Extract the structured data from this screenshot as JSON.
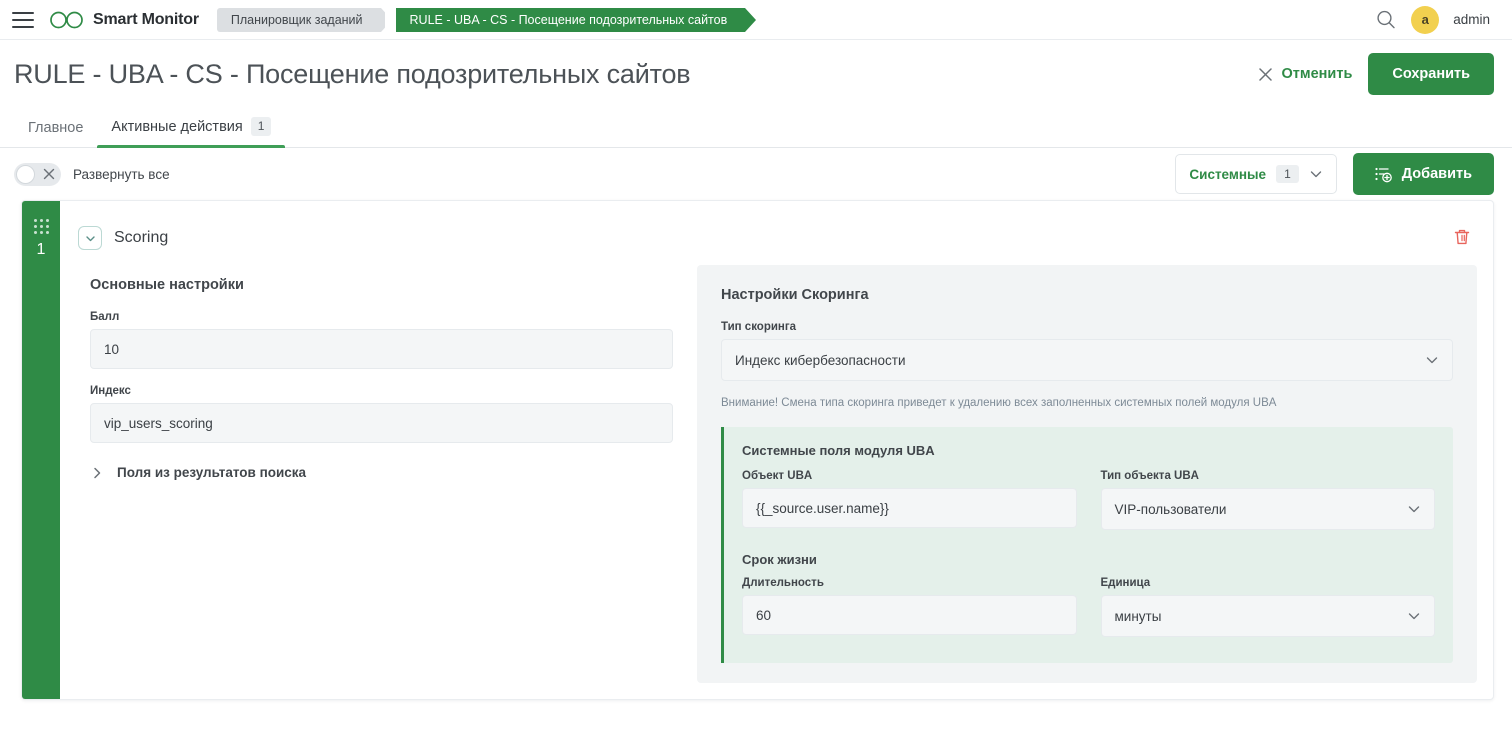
{
  "topbar": {
    "menu_icon": "hamburger-icon",
    "brand_name": "Smart Monitor",
    "breadcrumbs": [
      {
        "label": "Планировщик заданий",
        "active": false
      },
      {
        "label": "RULE - UBA - CS - Посещение подозрительных сайтов",
        "active": true
      }
    ],
    "search_icon": "search-icon",
    "avatar_initial": "a",
    "username": "admin"
  },
  "header": {
    "title": "RULE - UBA - CS - Посещение подозрительных сайтов",
    "cancel_label": "Отменить",
    "save_label": "Сохранить"
  },
  "tabs": [
    {
      "label": "Главное",
      "badge": "",
      "active": false
    },
    {
      "label": "Активные действия",
      "badge": "1",
      "active": true
    }
  ],
  "toolbar": {
    "expand_all_label": "Развернуть все",
    "toggle_state": "off",
    "system_label": "Системные",
    "system_badge": "1",
    "add_label": "Добавить"
  },
  "card": {
    "rail_number": "1",
    "title": "Scoring",
    "delete_icon": "trash-icon",
    "collapse_icon": "chevron-down-icon",
    "left": {
      "section_title": "Основные настройки",
      "score_label": "Балл",
      "score_value": "10",
      "index_label": "Индекс",
      "index_value": "vip_users_scoring",
      "expander_label": "Поля из результатов поиска"
    },
    "right": {
      "section_title": "Настройки Скоринга",
      "scoring_type_label": "Тип скоринга",
      "scoring_type_value": "Индекс кибербезопасности",
      "warning": "Внимание! Смена типа скоринга приведет к удалению всех заполненных системных полей модуля UBA",
      "uba_block_title": "Системные поля модуля UBA",
      "uba_object_label": "Объект UBA",
      "uba_object_value": "{{_source.user.name}}",
      "uba_object_type_label": "Тип объекта UBA",
      "uba_object_type_value": "VIP-пользователи",
      "lifetime_title": "Срок жизни",
      "duration_label": "Длительность",
      "duration_value": "60",
      "unit_label": "Единица",
      "unit_value": "минуты"
    }
  },
  "colors": {
    "brand_green": "#2f8b46",
    "accent_green": "#3f9e57",
    "avatar_yellow": "#f2d04f",
    "danger_red": "#e8645c"
  }
}
